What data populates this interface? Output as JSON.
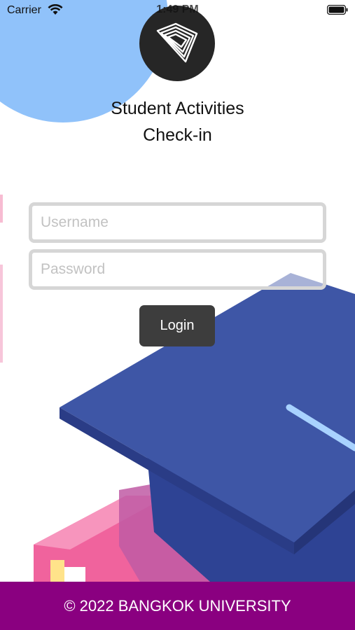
{
  "status_bar": {
    "carrier": "Carrier",
    "time": "1:49 PM",
    "wifi_icon": "wifi-icon",
    "battery_icon": "battery-icon"
  },
  "logo": {
    "icon": "diamond-logo-icon"
  },
  "title": {
    "line1": "Student Activities",
    "line2": "Check-in"
  },
  "form": {
    "username_placeholder": "Username",
    "username_value": "",
    "password_placeholder": "Password",
    "password_value": "",
    "login_label": "Login"
  },
  "footer": {
    "text": "© 2022 BANGKOK UNIVERSITY"
  },
  "colors": {
    "footer_bg": "#8a0080",
    "button_bg": "#3d3d3d",
    "accent_blue": "#3d55a4",
    "light_blue_circle": "#90c2fa",
    "pink": "#f0639d"
  }
}
